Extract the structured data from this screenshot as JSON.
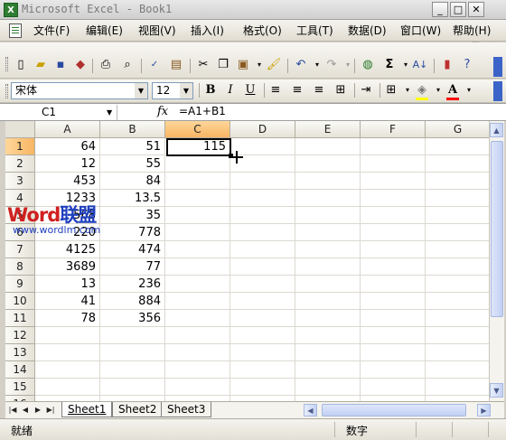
{
  "window": {
    "title": "Microsoft Excel - Book1",
    "app_icon": "X",
    "buttons": [
      "minimize",
      "restore",
      "close"
    ]
  },
  "menubar": {
    "items": [
      {
        "label": "文件(F)"
      },
      {
        "label": "编辑(E)"
      },
      {
        "label": "视图(V)"
      },
      {
        "label": "插入(I)"
      },
      {
        "label": "格式(O)"
      },
      {
        "label": "工具(T)"
      },
      {
        "label": "数据(D)"
      },
      {
        "label": "窗口(W)"
      },
      {
        "label": "帮助(H)"
      }
    ],
    "mdi_buttons": [
      "minimize",
      "restore",
      "close"
    ]
  },
  "toolbar_standard": {
    "icons": [
      "new-icon",
      "open-icon",
      "save-icon",
      "permission-icon",
      "print-icon",
      "print-preview-icon",
      "spelling-icon",
      "research-icon",
      "cut-icon",
      "copy-icon",
      "paste-icon",
      "format-painter-icon",
      "undo-icon",
      "redo-icon",
      "hyperlink-icon",
      "autosum-icon",
      "sort-ascending-icon",
      "chart-wizard-icon",
      "help-icon"
    ]
  },
  "toolbar_formatting": {
    "font_name": "宋体",
    "font_size": "12",
    "bold": "B",
    "italic": "I",
    "underline": "U",
    "font_color_letter": "A",
    "accent_colors": {
      "fill": "#ffff00",
      "font": "#ff0000"
    }
  },
  "formula_bar": {
    "name_box": "C1",
    "fx_label": "fx",
    "formula": "=A1+B1"
  },
  "sheet": {
    "columns": [
      "A",
      "B",
      "C",
      "D",
      "E",
      "F",
      "G"
    ],
    "selected_column": "C",
    "rows": [
      "1",
      "2",
      "3",
      "4",
      "5",
      "6",
      "7",
      "8",
      "9",
      "10",
      "11",
      "12",
      "13",
      "14",
      "15",
      "16"
    ],
    "selected_row": "1",
    "col_a": [
      "64",
      "12",
      "453",
      "1233",
      "568",
      "220",
      "4125",
      "3689",
      "13",
      "41",
      "78"
    ],
    "col_b": [
      "51",
      "55",
      "84",
      "13.5",
      "35",
      "778",
      "474",
      "77",
      "236",
      "884",
      "356"
    ],
    "c1": "115"
  },
  "watermark": {
    "logo": "Word联盟",
    "url": "www.wordlm.com",
    "colors": {
      "word": "#d02020",
      "lianmeng": "#1f3fbf"
    }
  },
  "tabs": {
    "sheets": [
      "Sheet1",
      "Sheet2",
      "Sheet3"
    ],
    "active": "Sheet1"
  },
  "status": {
    "left": "就绪",
    "mode": "数字"
  }
}
